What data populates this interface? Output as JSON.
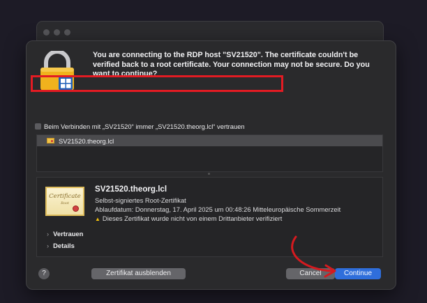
{
  "dialog": {
    "message": "You are connecting to the RDP host \"SV21520\". The certificate couldn't be verified back to a root certificate. Your connection may not be secure. Do you want to continue?",
    "trust_checkbox_label": "Beim Verbinden mit „SV21520“ immer „SV21520.theorg.lcl“ vertrauen",
    "trust_checkbox_checked": false,
    "cert_list": [
      {
        "label": "SV21520.theorg.lcl",
        "selected": true
      }
    ],
    "certificate": {
      "name": "SV21520.theorg.lcl",
      "type": "Selbst-signiertes Root-Zertifikat",
      "expiry": "Ablaufdatum: Donnerstag, 17. April 2025 um 00:48:26 Mitteleuropäische Sommerzeit",
      "warning": "Dieses Zertifikat wurde nicht von einem Drittanbieter verifiziert"
    },
    "disclosures": {
      "trust": "Vertrauen",
      "details": "Details"
    },
    "buttons": {
      "help": "?",
      "hide_certificate": "Zertifikat ausblenden",
      "cancel": "Cancel",
      "continue": "Continue"
    }
  },
  "icons": [
    "lock-icon",
    "windows-logo-icon",
    "certificate-icon",
    "warning-icon",
    "chevron-right-icon"
  ],
  "colors": {
    "accent": "#2f6edb",
    "annotation": "#e31b23",
    "warning": "#f4c20d"
  }
}
